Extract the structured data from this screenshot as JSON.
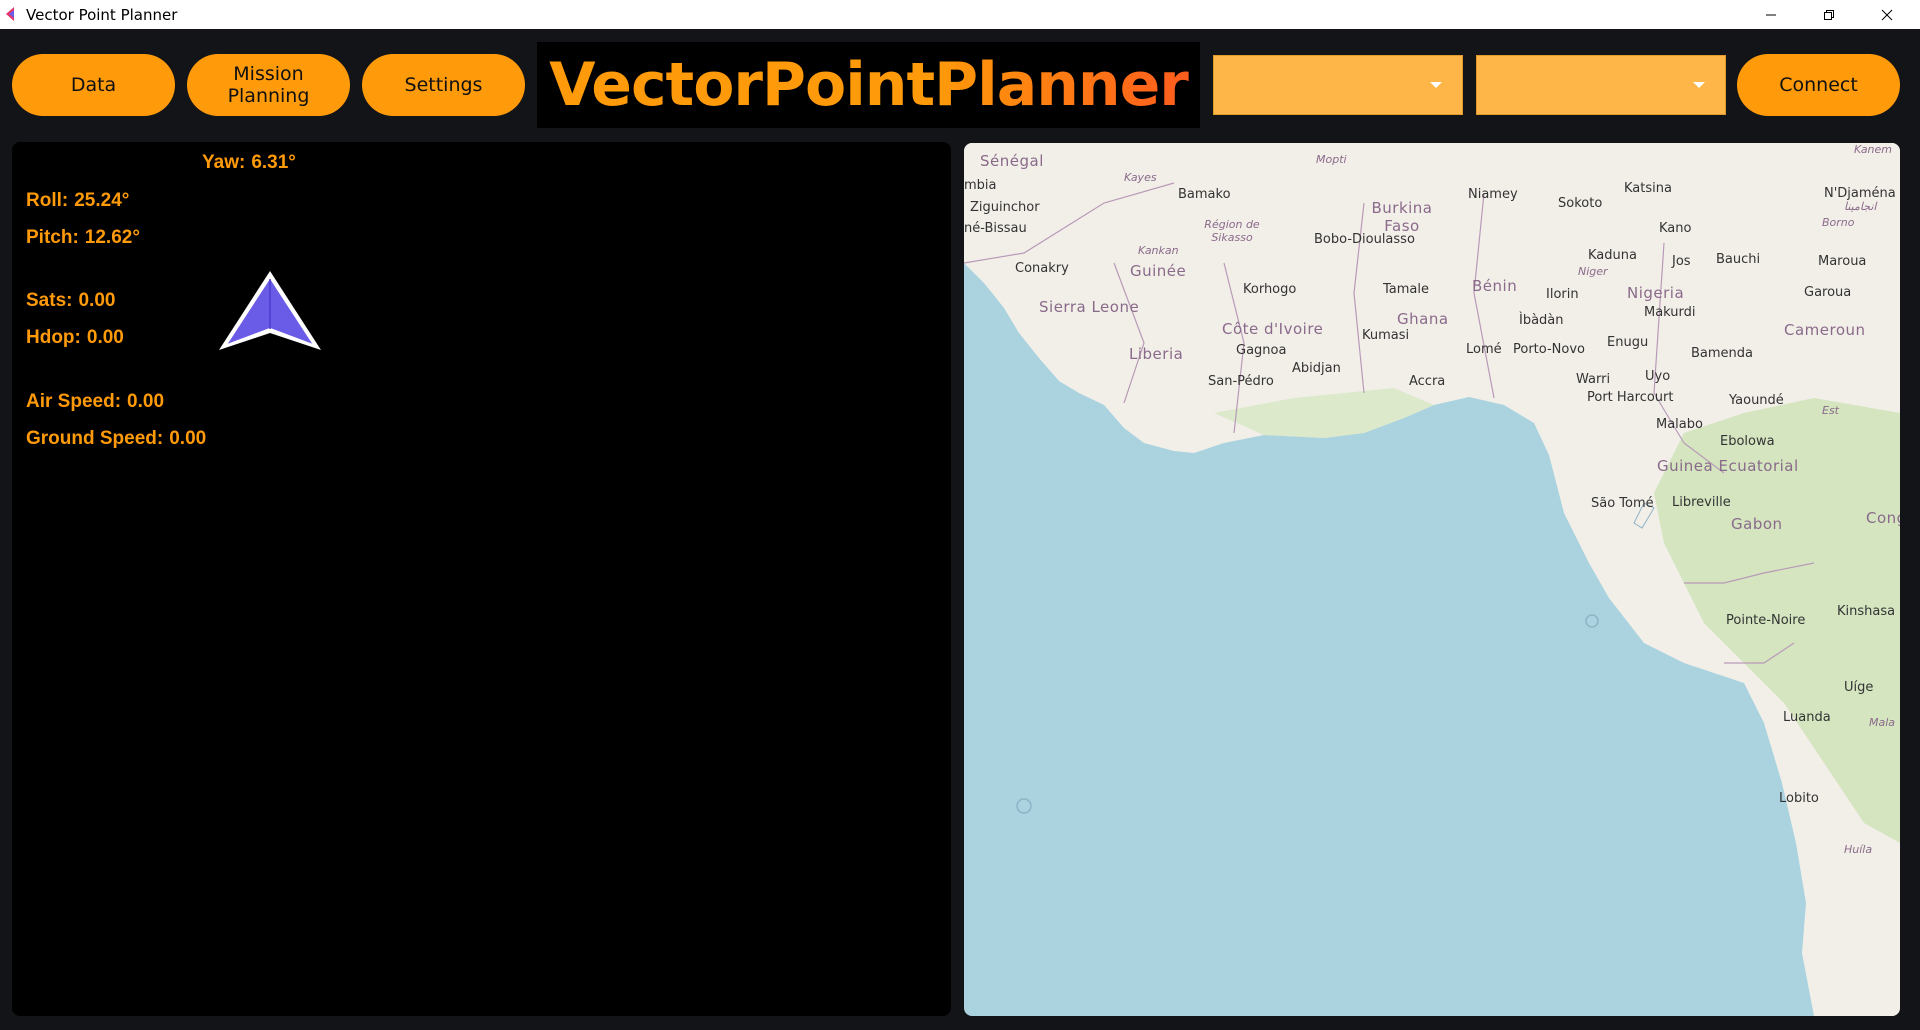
{
  "window": {
    "title": "Vector Point Planner",
    "controls": {
      "minimize": "—",
      "maximize": "❐",
      "close": "✕"
    }
  },
  "nav": {
    "data_label": "Data",
    "mission_label": "Mission Planning",
    "settings_label": "Settings",
    "connect_label": "Connect"
  },
  "brand": {
    "title": "VectorPointPlanner",
    "gradient": [
      "#ff9a0a",
      "#ff5a1e"
    ]
  },
  "dropdowns": [
    {
      "value": ""
    },
    {
      "value": ""
    }
  ],
  "telemetry": {
    "yaw": {
      "label": "Yaw:",
      "value": "6.31°"
    },
    "roll": {
      "label": "Roll:",
      "value": "25.24°"
    },
    "pitch": {
      "label": "Pitch:",
      "value": "12.62°"
    },
    "sats": {
      "label": "Sats:",
      "value": "0.00"
    },
    "hdop": {
      "label": "Hdop:",
      "value": "0.00"
    },
    "air_speed": {
      "label": "Air Speed:",
      "value": "0.00"
    },
    "ground_speed": {
      "label": "Ground Speed:",
      "value": "0.00"
    },
    "heading_icon": "navigation-arrow-icon"
  },
  "colors": {
    "accent": "#ff9a0a",
    "background": "#131418",
    "panel": "#000000",
    "sea": "#aad3df",
    "land": "#f2efe9",
    "heading_arrow": "#6b5ce7"
  },
  "map": {
    "countries": [
      "Sénégal",
      "Guinée",
      "Sierra Leone",
      "Liberia",
      "Côte d'Ivoire",
      "Ghana",
      "Burkina Faso",
      "Bénin",
      "Nigeria",
      "Cameroun",
      "Guinea Ecuatorial",
      "Gabon",
      "Cong"
    ],
    "cities": [
      "Bamako",
      "Ziguinchor",
      "né-Bissau",
      "Conakry",
      "Korhogo",
      "Bobo-Dioulasso",
      "Niamey",
      "Sokoto",
      "Katsina",
      "Kano",
      "Kaduna",
      "Jos",
      "Bauchi",
      "Maroua",
      "Garoua",
      "Makurdi",
      "Tamale",
      "Kumasi",
      "Abidjan",
      "Gagnoa",
      "San-Pédro",
      "Accra",
      "Lomé",
      "Porto-Novo",
      "Ilorin",
      "Ìbàdàn",
      "Enugu",
      "Warri",
      "Uyo",
      "Port Harcourt",
      "Bamenda",
      "Malabo",
      "Yaoundé",
      "Ebolowa",
      "São Tomé",
      "Libreville",
      "Pointe-Noire",
      "Kinshasa",
      "Uíge",
      "Luanda",
      "Lobito",
      "N'Djaména",
      "mbia"
    ],
    "regions": [
      "Kayes",
      "Mopti",
      "Région de Sikasso",
      "Kankan",
      "Niger",
      "Borno",
      "Est",
      "Kanem",
      "Huíla",
      "Mala",
      "انجامينا"
    ]
  }
}
